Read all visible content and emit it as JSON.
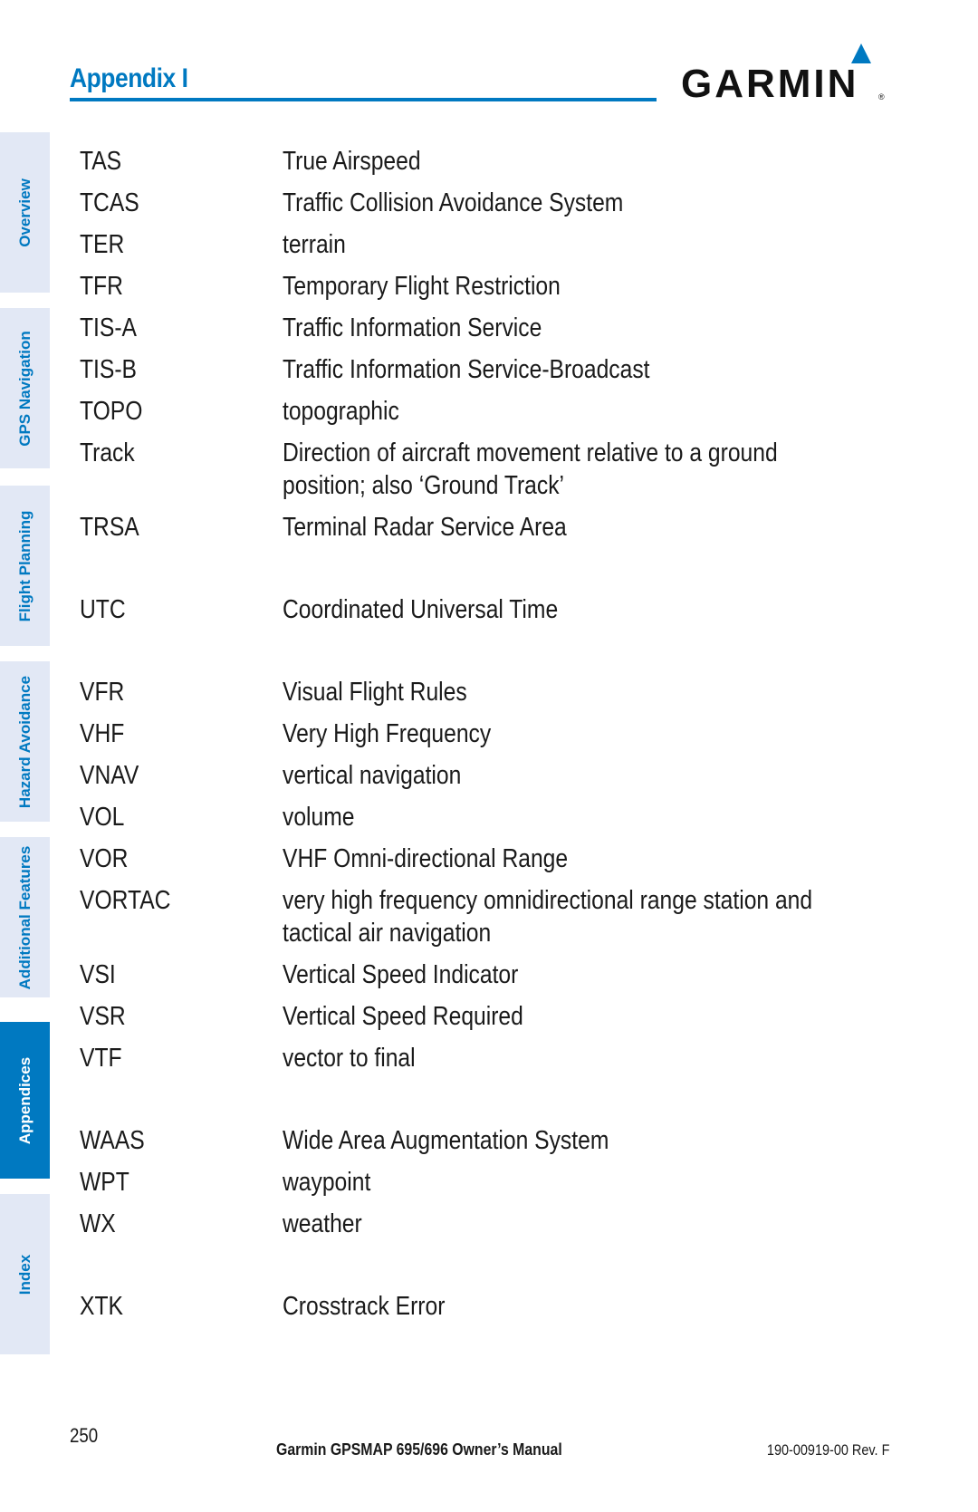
{
  "header": {
    "section_title": "Appendix I",
    "logo_text": "GARMIN",
    "logo_mark": "®",
    "accent_color": "#0079c1"
  },
  "sidebar": {
    "tabs": [
      {
        "label": "Overview",
        "active": false
      },
      {
        "label": "GPS Navigation",
        "active": false
      },
      {
        "label": "Flight Planning",
        "active": false
      },
      {
        "label": "Hazard Avoidance",
        "active": false
      },
      {
        "label": "Additional Features",
        "active": false
      },
      {
        "label": "Appendices",
        "active": true
      },
      {
        "label": "Index",
        "active": false
      }
    ]
  },
  "glossary": {
    "groups": [
      {
        "entries": [
          {
            "term": "TAS",
            "definition": [
              "True Airspeed"
            ]
          },
          {
            "term": "TCAS",
            "definition": [
              "Traffic Collision Avoidance System"
            ]
          },
          {
            "term": "TER",
            "definition": [
              "terrain"
            ]
          },
          {
            "term": "TFR",
            "definition": [
              "Temporary Flight Restriction"
            ]
          },
          {
            "term": "TIS-A",
            "definition": [
              "Traffic Information Service"
            ]
          },
          {
            "term": "TIS-B",
            "definition": [
              "Traffic Information Service-Broadcast"
            ]
          },
          {
            "term": "TOPO",
            "definition": [
              "topographic"
            ]
          },
          {
            "term": "Track",
            "definition": [
              "Direction of aircraft movement relative to a ground",
              "position; also ‘Ground Track’"
            ]
          },
          {
            "term": "TRSA",
            "definition": [
              "Terminal Radar Service Area"
            ]
          }
        ]
      },
      {
        "entries": [
          {
            "term": "UTC",
            "definition": [
              "Coordinated Universal Time"
            ]
          }
        ]
      },
      {
        "entries": [
          {
            "term": "VFR",
            "definition": [
              "Visual Flight Rules"
            ]
          },
          {
            "term": "VHF",
            "definition": [
              "Very High Frequency"
            ]
          },
          {
            "term": "VNAV",
            "definition": [
              "vertical navigation"
            ]
          },
          {
            "term": "VOL",
            "definition": [
              "volume"
            ]
          },
          {
            "term": "VOR",
            "definition": [
              "VHF Omni-directional Range"
            ]
          },
          {
            "term": "VORTAC",
            "definition": [
              "very high frequency omnidirectional range station and",
              "tactical air navigation"
            ]
          },
          {
            "term": "VSI",
            "definition": [
              "Vertical Speed Indicator"
            ]
          },
          {
            "term": "VSR",
            "definition": [
              "Vertical Speed Required"
            ]
          },
          {
            "term": "VTF",
            "definition": [
              "vector to final"
            ]
          }
        ]
      },
      {
        "entries": [
          {
            "term": "WAAS",
            "definition": [
              "Wide Area Augmentation System"
            ]
          },
          {
            "term": "WPT",
            "definition": [
              "waypoint"
            ]
          },
          {
            "term": "WX",
            "definition": [
              "weather"
            ]
          }
        ]
      },
      {
        "entries": [
          {
            "term": "XTK",
            "definition": [
              "Crosstrack Error"
            ]
          }
        ]
      }
    ]
  },
  "footer": {
    "page_number": "250",
    "manual_title": "Garmin GPSMAP 695/696 Owner’s Manual",
    "doc_revision": "190-00919-00  Rev. F"
  }
}
